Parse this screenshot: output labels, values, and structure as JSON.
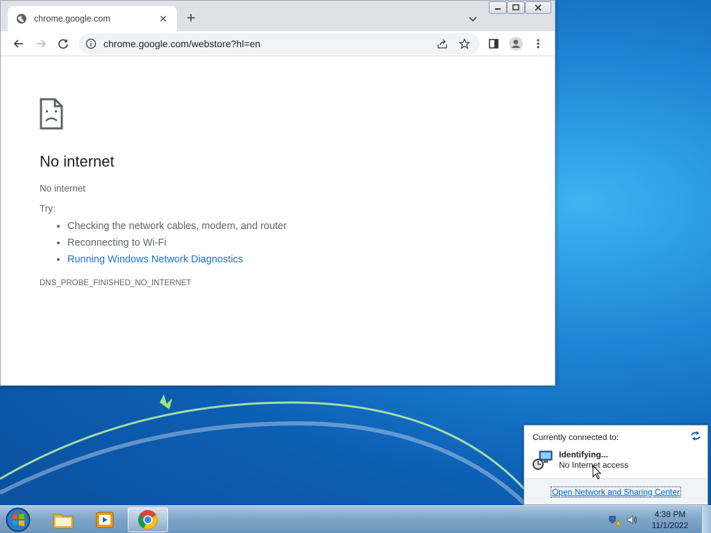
{
  "browser": {
    "tab": {
      "title": "chrome.google.com",
      "favicon": "globe-icon",
      "close_glyph": "✕"
    },
    "new_tab_glyph": "+",
    "address": {
      "url": "chrome.google.com/webstore?hl=en"
    },
    "accent": "#1a73e8"
  },
  "page": {
    "icon": "sad-page-icon",
    "heading": "No internet",
    "subtitle": "No internet",
    "try_label": "Try:",
    "suggestions": [
      "Checking the network cables, modem, and router",
      "Reconnecting to Wi-Fi",
      "Running Windows Network Diagnostics"
    ],
    "error_code": "DNS_PROBE_FINISHED_NO_INTERNET"
  },
  "network_flyout": {
    "header": "Currently connected to:",
    "network_name": "Identifying...",
    "network_status": "No Internet access",
    "link": "Open Network and Sharing Center"
  },
  "taskbar": {
    "apps": [
      "windows-explorer",
      "media-player",
      "google-chrome"
    ],
    "clock": {
      "time": "4:38 PM",
      "date": "11/1/2022"
    }
  }
}
